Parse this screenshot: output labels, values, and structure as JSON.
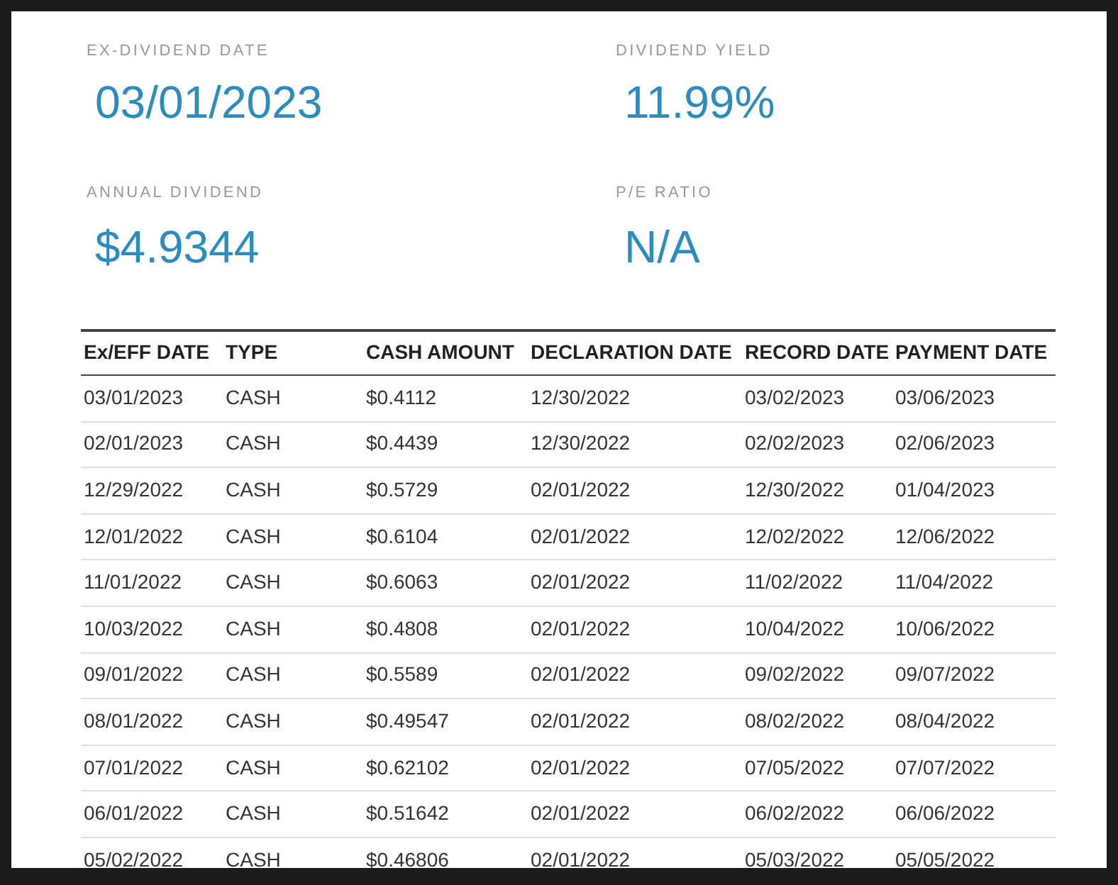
{
  "stats": [
    {
      "label": "EX-DIVIDEND DATE",
      "value": "03/01/2023"
    },
    {
      "label": "DIVIDEND YIELD",
      "value": "11.99%"
    },
    {
      "label": "ANNUAL DIVIDEND",
      "value": "$4.9344"
    },
    {
      "label": "P/E RATIO",
      "value": "N/A"
    }
  ],
  "table": {
    "columns": [
      "Ex/EFF DATE",
      "TYPE",
      "CASH AMOUNT",
      "DECLARATION DATE",
      "RECORD DATE",
      "PAYMENT DATE"
    ],
    "rows": [
      [
        "03/01/2023",
        "CASH",
        "$0.4112",
        "12/30/2022",
        "03/02/2023",
        "03/06/2023"
      ],
      [
        "02/01/2023",
        "CASH",
        "$0.4439",
        "12/30/2022",
        "02/02/2023",
        "02/06/2023"
      ],
      [
        "12/29/2022",
        "CASH",
        "$0.5729",
        "02/01/2022",
        "12/30/2022",
        "01/04/2023"
      ],
      [
        "12/01/2022",
        "CASH",
        "$0.6104",
        "02/01/2022",
        "12/02/2022",
        "12/06/2022"
      ],
      [
        "11/01/2022",
        "CASH",
        "$0.6063",
        "02/01/2022",
        "11/02/2022",
        "11/04/2022"
      ],
      [
        "10/03/2022",
        "CASH",
        "$0.4808",
        "02/01/2022",
        "10/04/2022",
        "10/06/2022"
      ],
      [
        "09/01/2022",
        "CASH",
        "$0.5589",
        "02/01/2022",
        "09/02/2022",
        "09/07/2022"
      ],
      [
        "08/01/2022",
        "CASH",
        "$0.49547",
        "02/01/2022",
        "08/02/2022",
        "08/04/2022"
      ],
      [
        "07/01/2022",
        "CASH",
        "$0.62102",
        "02/01/2022",
        "07/05/2022",
        "07/07/2022"
      ],
      [
        "06/01/2022",
        "CASH",
        "$0.51642",
        "02/01/2022",
        "06/02/2022",
        "06/06/2022"
      ],
      [
        "05/02/2022",
        "CASH",
        "$0.46806",
        "02/01/2022",
        "05/03/2022",
        "05/05/2022"
      ]
    ]
  }
}
